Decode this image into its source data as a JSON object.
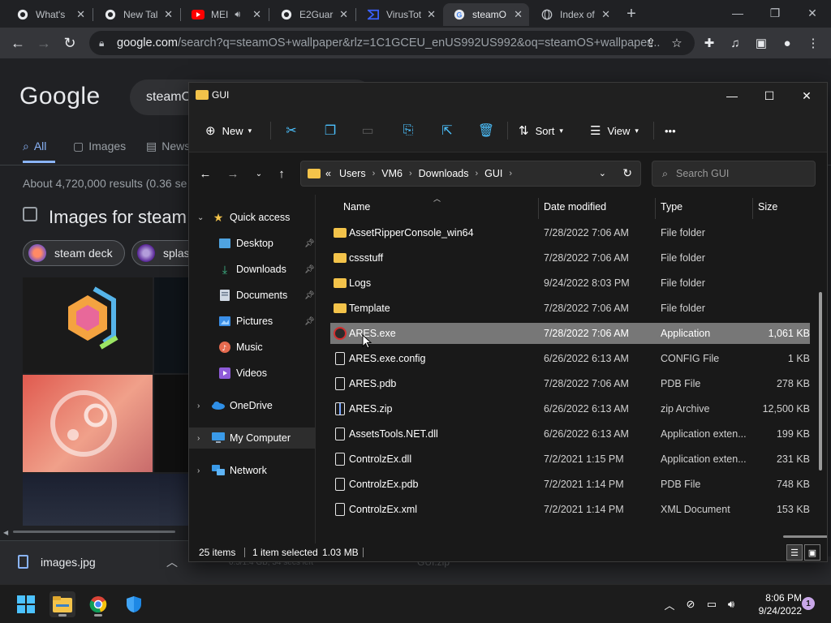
{
  "chrome": {
    "tabs": [
      {
        "title": "What's",
        "icon": "github-icon"
      },
      {
        "title": "New Tal",
        "icon": "github-icon"
      },
      {
        "title": "MEI",
        "icon": "youtube-icon"
      },
      {
        "title": "E2Guar",
        "icon": "github-icon"
      },
      {
        "title": "VirusTot",
        "icon": "virustotal-icon"
      },
      {
        "title": "steamO",
        "icon": "google-icon"
      },
      {
        "title": "Index of",
        "icon": "globe-icon"
      }
    ],
    "url_host": "google.com",
    "url_path": "/search?q=steamOS+wallpaper&rlz=1C1GCEU_enUS992US992&oq=steamOS+wallpaper..."
  },
  "google": {
    "logo": "Google",
    "query": "steamO",
    "tabs": [
      "All",
      "Images",
      "News"
    ],
    "stats": "About 4,720,000 results (0.36 se",
    "images_title": "Images for steam",
    "chips": [
      "steam deck",
      "splas"
    ]
  },
  "download": {
    "file": "images.jpg",
    "behind_item": "GUI.zip",
    "behind_progress": "0.5/1.4 GB, 34 secs left"
  },
  "explorer": {
    "title": "GUI",
    "cmd": {
      "new": "New",
      "sort": "Sort",
      "view": "View",
      "more": "•••"
    },
    "breadcrumb": [
      "Users",
      "VM6",
      "Downloads",
      "GUI"
    ],
    "breadcrumb_lead": "«",
    "search_placeholder": "Search GUI",
    "nav": {
      "quick_access": "Quick access",
      "desktop": "Desktop",
      "downloads": "Downloads",
      "documents": "Documents",
      "pictures": "Pictures",
      "music": "Music",
      "videos": "Videos",
      "onedrive": "OneDrive",
      "my_computer": "My Computer",
      "network": "Network"
    },
    "columns": {
      "name": "Name",
      "date": "Date modified",
      "type": "Type",
      "size": "Size"
    },
    "files": [
      {
        "name": "AssetRipperConsole_win64",
        "date": "7/28/2022 7:06 AM",
        "type": "File folder",
        "size": "",
        "kind": "folder"
      },
      {
        "name": "cssstuff",
        "date": "7/28/2022 7:06 AM",
        "type": "File folder",
        "size": "",
        "kind": "folder"
      },
      {
        "name": "Logs",
        "date": "9/24/2022 8:03 PM",
        "type": "File folder",
        "size": "",
        "kind": "folder"
      },
      {
        "name": "Template",
        "date": "7/28/2022 7:06 AM",
        "type": "File folder",
        "size": "",
        "kind": "folder"
      },
      {
        "name": "ARES.exe",
        "date": "7/28/2022 7:06 AM",
        "type": "Application",
        "size": "1,061 KB",
        "kind": "app"
      },
      {
        "name": "ARES.exe.config",
        "date": "6/26/2022 6:13 AM",
        "type": "CONFIG File",
        "size": "1 KB",
        "kind": "file"
      },
      {
        "name": "ARES.pdb",
        "date": "7/28/2022 7:06 AM",
        "type": "PDB File",
        "size": "278 KB",
        "kind": "file"
      },
      {
        "name": "ARES.zip",
        "date": "6/26/2022 6:13 AM",
        "type": "zip Archive",
        "size": "12,500 KB",
        "kind": "zip"
      },
      {
        "name": "AssetsTools.NET.dll",
        "date": "6/26/2022 6:13 AM",
        "type": "Application exten...",
        "size": "199 KB",
        "kind": "file"
      },
      {
        "name": "ControlzEx.dll",
        "date": "7/2/2021 1:15 PM",
        "type": "Application exten...",
        "size": "231 KB",
        "kind": "file"
      },
      {
        "name": "ControlzEx.pdb",
        "date": "7/2/2021 1:14 PM",
        "type": "PDB File",
        "size": "748 KB",
        "kind": "file"
      },
      {
        "name": "ControlzEx.xml",
        "date": "7/2/2021 1:14 PM",
        "type": "XML Document",
        "size": "153 KB",
        "kind": "file"
      }
    ],
    "selected_index": 4,
    "status": {
      "count": "25 items",
      "selected": "1 item selected",
      "size": "1.03 MB"
    }
  },
  "taskbar": {
    "time": "8:06 PM",
    "date": "9/24/2022",
    "notifications": "1"
  },
  "colors": {
    "accent": "#4cc2ff",
    "folder": "#f3c34a",
    "link": "#8ab4f8",
    "selection": "#777777"
  }
}
